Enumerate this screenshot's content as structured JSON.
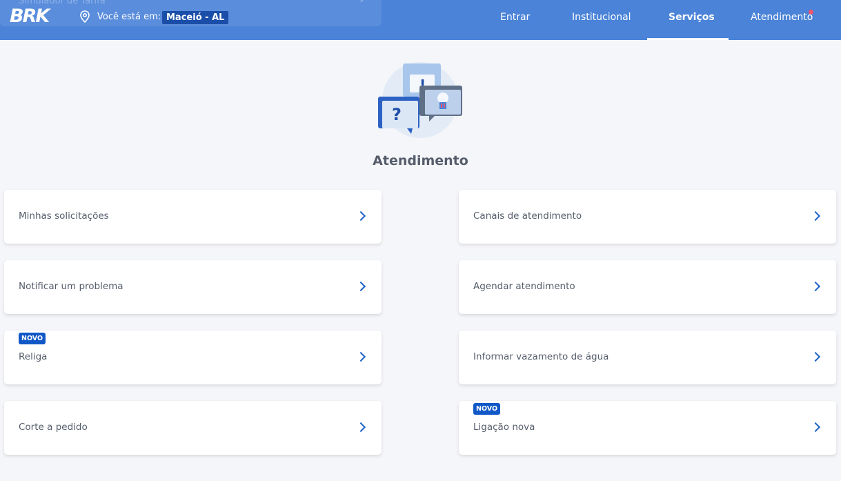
{
  "header": {
    "logo": "BRK",
    "location_label": "Você está em:",
    "location_value": "Maceió - AL",
    "ghost_card_label": "Simulador de Tarifa",
    "nav": [
      {
        "label": "Entrar"
      },
      {
        "label": "Institucional"
      },
      {
        "label": "Serviços",
        "active": true
      },
      {
        "label": "Atendimento",
        "notification": true
      }
    ]
  },
  "hero": {
    "icon": "support-chat-icon"
  },
  "page": {
    "title": "Atendimento"
  },
  "cards": [
    {
      "label": "Minhas solicitações"
    },
    {
      "label": "Canais de atendimento"
    },
    {
      "label": "Notificar um problema"
    },
    {
      "label": "Agendar atendimento"
    },
    {
      "label": "Religa",
      "badge": "NOVO"
    },
    {
      "label": "Informar vazamento de água"
    },
    {
      "label": "Corte a pedido"
    },
    {
      "label": "Ligação nova",
      "badge": "NOVO"
    }
  ],
  "colors": {
    "header": "#4a83d8",
    "accent": "#1d63c8",
    "badge": "#1158c7",
    "notification": "#f0546c",
    "background": "#f5f6f9"
  }
}
